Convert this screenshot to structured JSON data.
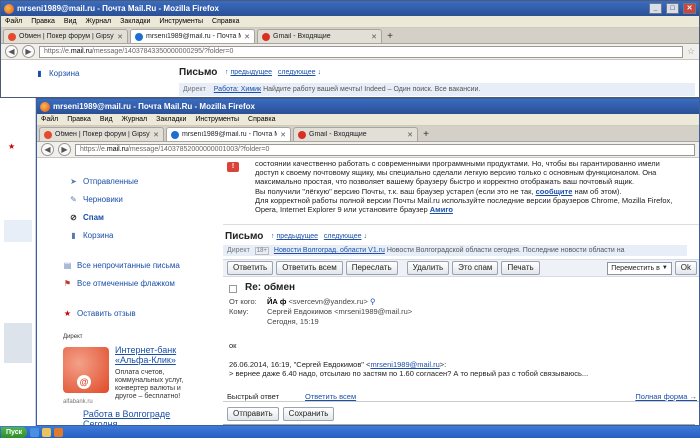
{
  "back_window": {
    "title": "mrseni1989@mail.ru - Почта Mail.Ru - Mozilla Firefox",
    "menu": [
      "Файл",
      "Правка",
      "Вид",
      "Журнал",
      "Закладки",
      "Инструменты",
      "Справка"
    ],
    "tabs": [
      {
        "label": "Обмен | Покер форум | GipsyTeam",
        "color": "#e34b2c",
        "active": false
      },
      {
        "label": "mrseni1989@mail.ru - Почта Mail.Ru",
        "color": "#1f6fd0",
        "active": true
      },
      {
        "label": "Gmail - Входящие",
        "color": "#d93025",
        "active": false
      }
    ],
    "url_pre": "https://e.",
    "url_host": "mail.ru",
    "url_post": "/message/14037843350000000295/?folder=0",
    "sidebar": [
      {
        "label": "Корзина"
      }
    ],
    "heading": "Письмо",
    "prev": "предыдущее",
    "next": "следующее",
    "ad_tag": "Директ",
    "ad_link": "Работа: Химик",
    "ad_text": "Найдите работу вашей мечты! Indeed – Один поиск. Все вакансии."
  },
  "window": {
    "title": "mrseni1989@mail.ru - Почта Mail.Ru - Mozilla Firefox",
    "menu": [
      "Файл",
      "Правка",
      "Вид",
      "Журнал",
      "Закладки",
      "Инструменты",
      "Справка"
    ],
    "tabs": [
      {
        "label": "Обмен | Покер форум | GipsyTeam",
        "color": "#e34b2c",
        "active": false
      },
      {
        "label": "mrseni1989@mail.ru - Почта Mail.Ru",
        "color": "#1f6fd0",
        "active": true
      },
      {
        "label": "Gmail - Входящие",
        "color": "#d93025",
        "active": false
      }
    ],
    "url_pre": "https://e.",
    "url_host": "mail.ru",
    "url_post": "/message/14037852000000001003/?folder=0"
  },
  "sidebar": {
    "folders": [
      {
        "label": "Отправленные",
        "icon": "sent-icon",
        "glyph": "➤"
      },
      {
        "label": "Черновики",
        "icon": "drafts-icon",
        "glyph": "✎"
      },
      {
        "label": "Спам",
        "icon": "spam-icon",
        "glyph": "⊘",
        "bold": true
      },
      {
        "label": "Корзина",
        "icon": "trash-icon",
        "glyph": "▮"
      }
    ],
    "filters": [
      {
        "label": "Все непрочитанные письма",
        "icon": "unread-icon",
        "glyph": "▤"
      },
      {
        "label": "Все отмеченные флажком",
        "icon": "flag-icon",
        "glyph": "⚑"
      }
    ],
    "feedback": "Оставить отзыв",
    "ad": {
      "tag": "Директ",
      "title": "Интернет-банк «Альфа-Клик»",
      "text": "Оплата счетов, коммунальных услуг, конвертер валюты и другое – бесплатно!",
      "domain": "alfabank.ru"
    },
    "job_link": "Работа в Волгограде Сегодня"
  },
  "notice": [
    "состоянии качественно работать с современными программными продуктами. Но, чтобы вы гарантированно имели",
    "доступ к своему почтовому ящику, мы специально сделали легкую версию только с основным функционалом. Она",
    "максимально простая, что позволяет вашему браузеру быстро и корректно отображать ваш почтовый ящик."
  ],
  "notice_line4_pre": "Вы получили \"лёгкую\" версию Почты, т.к. ваш браузер устарел (если это не так,",
  "notice_report_link": "сообщите",
  "notice_line4_post": "нам об этом).",
  "notice_line5": "Для корректной работы полной версии Почты Mail.ru используйте последние версии браузеров Chrome, Mozilla Firefox,",
  "notice_line6_pre": "Opera, Internet Explorer 9 или установите браузер",
  "notice_amigo": "Амиго",
  "message": {
    "heading": "Письмо",
    "prev": "предыдущее",
    "next": "следующее",
    "ad_tag": "Директ",
    "ad_age": "18+",
    "ad_link": "Новости Волгоград. области V1.ru",
    "ad_text": "Новости Волгоградской области сегодня. Последние новости области на",
    "toolbar": [
      "Ответить",
      "Ответить всем",
      "Переслать",
      "Удалить",
      "Это спам",
      "Печать"
    ],
    "move_select": "Переместить в",
    "ok": "Ok",
    "subject": "Re: обмен",
    "from_label": "От кого:",
    "from_name": "ЙА ф",
    "from_email": "<svercevn@yandex.ru>",
    "to_label": "Кому:",
    "to_value": "Сергей Евдокимов <mrseni1989@mail.ru>",
    "date_label": "Сегодня, 15:19",
    "body_ok": "ок",
    "quote_pre": "26.06.2014, 16:19, \"Сергей Евдокимов\" <",
    "quote_email": "mrseni1989@mail.ru",
    "quote_post": ">:",
    "quote_text": "> вернее даже 6.40 надо, отсылаю по застям по 1.60 согласен? А то первый раз с тобой связываюсь...",
    "reply_tab": "Быстрый ответ",
    "reply_all_tab": "Ответить всем",
    "full_form": "Полная форма →",
    "send": "Отправить",
    "save": "Сохранить"
  },
  "taskbar": {
    "start": "Пуск"
  }
}
